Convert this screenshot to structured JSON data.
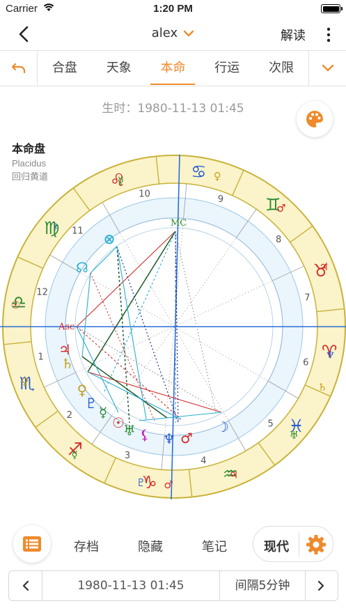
{
  "status": {
    "carrier": "Carrier",
    "time": "1:20 PM"
  },
  "nav": {
    "title": "alex",
    "read_label": "解读"
  },
  "tabs": [
    {
      "label": "合盘",
      "active": false
    },
    {
      "label": "天象",
      "active": false
    },
    {
      "label": "本命",
      "active": true
    },
    {
      "label": "行运",
      "active": false
    },
    {
      "label": "次限",
      "active": false
    }
  ],
  "birth": {
    "text": "生时：1980-11-13 01:45"
  },
  "chart_info": {
    "type": "本命盘",
    "house_system": "Placidus",
    "zodiac": "回归黄道"
  },
  "wheel": {
    "angle_labels": {
      "asc": "Asc",
      "mc": "MC"
    },
    "house_numbers": [
      "1",
      "2",
      "3",
      "4",
      "5",
      "6",
      "7",
      "8",
      "9",
      "10",
      "11",
      "12"
    ],
    "signs": [
      {
        "glyph": "♎",
        "color": "#2a8a30",
        "name": "libra"
      },
      {
        "glyph": "♍",
        "color": "#2a8a30",
        "name": "virgo"
      },
      {
        "glyph": "♌",
        "color": "#d42a2a",
        "name": "leo"
      },
      {
        "glyph": "♋",
        "color": "#2a5fd0",
        "name": "cancer"
      },
      {
        "glyph": "♊",
        "color": "#2a8a30",
        "name": "gemini"
      },
      {
        "glyph": "♉",
        "color": "#d42a2a",
        "name": "taurus"
      },
      {
        "glyph": "♈",
        "color": "#d42a2a",
        "name": "aries"
      },
      {
        "glyph": "♓",
        "color": "#2a5fd0",
        "name": "pisces"
      },
      {
        "glyph": "♒",
        "color": "#2a8a30",
        "name": "aquarius"
      },
      {
        "glyph": "♑",
        "color": "#d42a2a",
        "name": "capricorn"
      },
      {
        "glyph": "♐",
        "color": "#d42a2a",
        "name": "sagittarius"
      },
      {
        "glyph": "♏",
        "color": "#2a5fd0",
        "name": "scorpio"
      }
    ],
    "rulers": [
      {
        "glyph": "♀",
        "color": "#c8a020"
      },
      {
        "glyph": "☿",
        "color": "#2a8a30"
      },
      {
        "glyph": "☉",
        "color": "#d42a2a"
      },
      {
        "glyph": "☽",
        "color": "#2a5fd0"
      },
      {
        "glyph": "☿",
        "color": "#2a8a30"
      },
      {
        "glyph": "♀",
        "color": "#c8a020"
      },
      {
        "glyph": "♂",
        "color": "#d42a2a"
      },
      {
        "glyph": "♃",
        "color": "#d42a2a"
      },
      {
        "glyph": "♆",
        "color": "#2a5fd0"
      },
      {
        "glyph": "♄",
        "color": "#c8a020"
      },
      {
        "glyph": "♅",
        "color": "#2a8a30"
      },
      {
        "glyph": "♃",
        "color": "#d42a2a"
      },
      {
        "glyph": "♂",
        "color": "#d42a2a"
      },
      {
        "glyph": "♇",
        "color": "#2a5fd0"
      }
    ],
    "planets": [
      {
        "name": "north-node",
        "glyph": "☊",
        "color": "#2aaed0"
      },
      {
        "name": "part-of-fortune",
        "glyph": "⊗",
        "color": "#2aaed0"
      },
      {
        "name": "jupiter",
        "glyph": "♃",
        "color": "#d42a2a"
      },
      {
        "name": "saturn",
        "glyph": "♄",
        "color": "#c8a020"
      },
      {
        "name": "venus",
        "glyph": "♀",
        "color": "#c8a020"
      },
      {
        "name": "pluto",
        "glyph": "♇",
        "color": "#2a5fd0"
      },
      {
        "name": "mercury",
        "glyph": "☿",
        "color": "#2a8a30"
      },
      {
        "name": "sun",
        "glyph": "☉",
        "color": "#d42a2a"
      },
      {
        "name": "uranus",
        "glyph": "♅",
        "color": "#2a8a30"
      },
      {
        "name": "lilith",
        "glyph": "⚸",
        "color": "#c020c0"
      },
      {
        "name": "neptune",
        "glyph": "♆",
        "color": "#2a5fd0"
      },
      {
        "name": "mars",
        "glyph": "♂",
        "color": "#d42a2a"
      },
      {
        "name": "moon",
        "glyph": "☽",
        "color": "#2a5fd0"
      }
    ],
    "colors": {
      "ring_fill": "#fbf3c9",
      "ring_stroke": "#c8b23a",
      "inner_fill": "#eaf5fc",
      "axis": "#2a6fd6"
    }
  },
  "bottom": {
    "archive_label": "存档",
    "hide_label": "隐藏",
    "notes_label": "笔记",
    "mode_label": "现代"
  },
  "time_bar": {
    "date": "1980-11-13 01:45",
    "interval": "间隔5分钟"
  },
  "accent_color": "#ef8a2c"
}
